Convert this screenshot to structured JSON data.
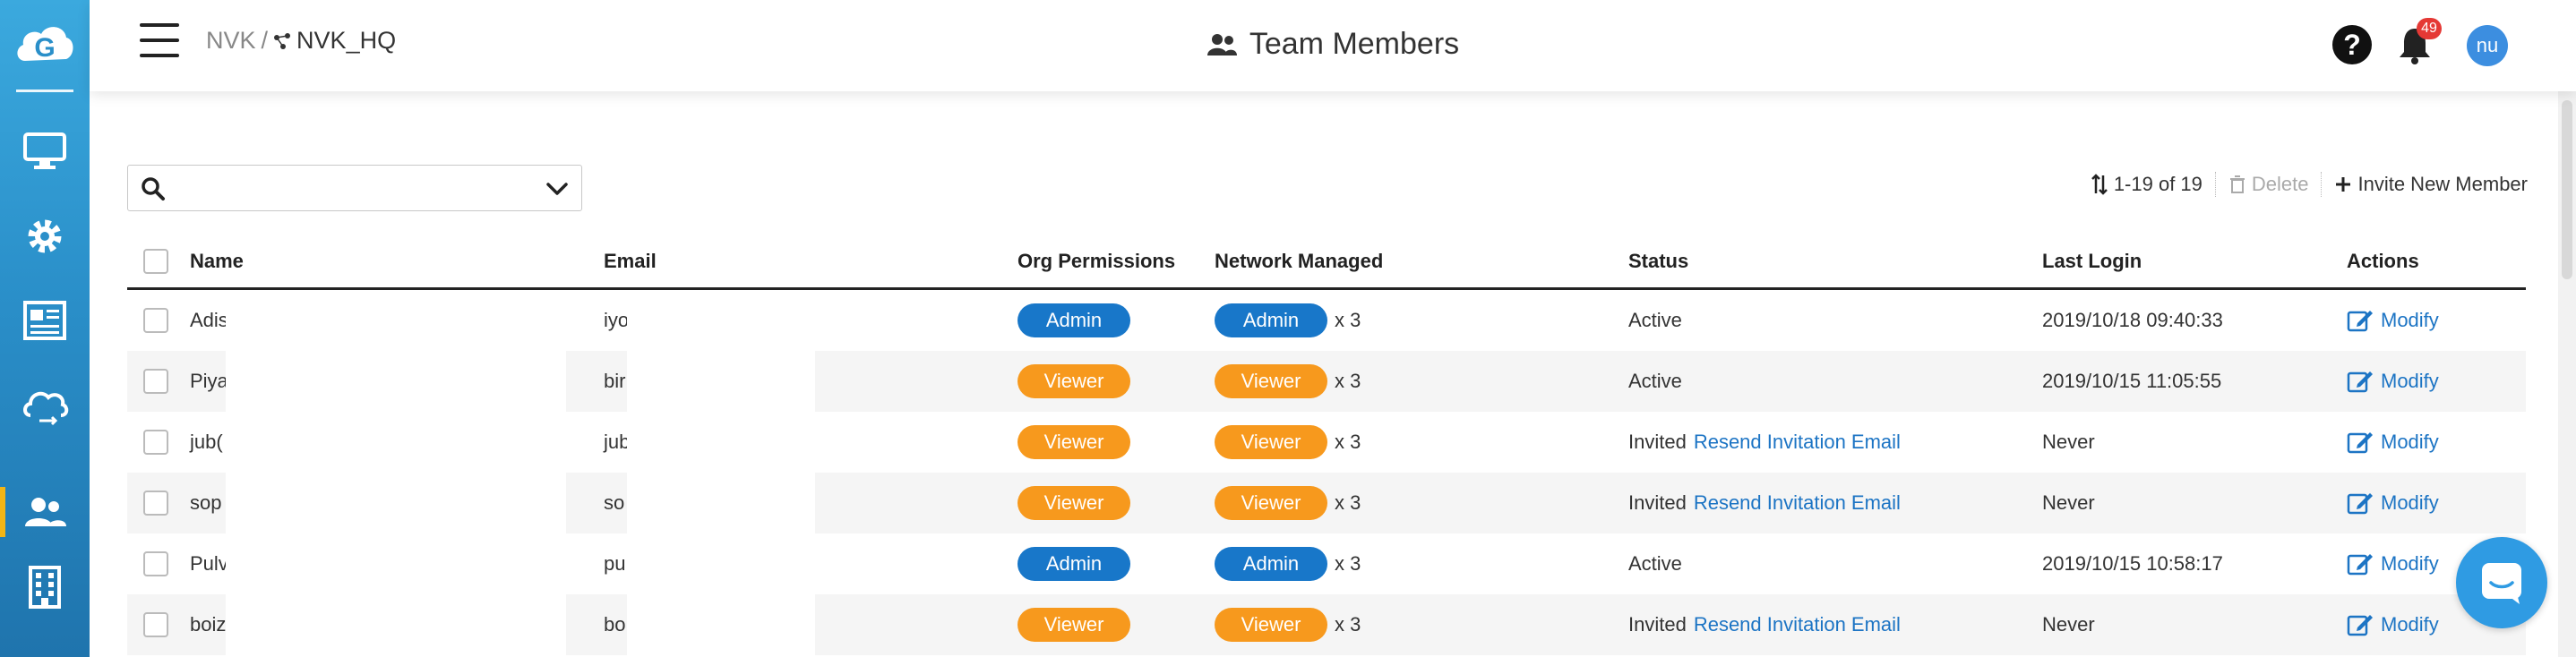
{
  "breadcrumb": {
    "org": "NVK",
    "separator": "/",
    "network": "NVK_HQ"
  },
  "header": {
    "title": "Team Members",
    "notification_count": "49",
    "avatar_initials": "nu"
  },
  "sidebar": {
    "items": [
      {
        "icon": "monitor-icon"
      },
      {
        "icon": "gear-icon"
      },
      {
        "icon": "report-icon"
      },
      {
        "icon": "cloud-sync-icon"
      },
      {
        "icon": "team-icon",
        "active": true
      },
      {
        "icon": "building-icon"
      }
    ],
    "active_color": "#f2b516"
  },
  "search": {
    "placeholder": "",
    "value": ""
  },
  "toolbar": {
    "count_label": "1-19 of 19",
    "delete_label": "Delete",
    "invite_label": "Invite New Member"
  },
  "table": {
    "columns": [
      "Name",
      "Email",
      "Org Permissions",
      "Network Managed",
      "Status",
      "Last Login",
      "Actions"
    ],
    "rows": [
      {
        "name": "Adis",
        "email": "iyo",
        "org_perm": "Admin",
        "net_perm": "Admin",
        "net_mult": "x 3",
        "status": "Active",
        "resend": "",
        "last_login": "2019/10/18 09:40:33",
        "action": "Modify"
      },
      {
        "name": "Piya",
        "email": "bir",
        "org_perm": "Viewer",
        "net_perm": "Viewer",
        "net_mult": "x 3",
        "status": "Active",
        "resend": "",
        "last_login": "2019/10/15 11:05:55",
        "action": "Modify"
      },
      {
        "name": "jub(",
        "email": "jub",
        "org_perm": "Viewer",
        "net_perm": "Viewer",
        "net_mult": "x 3",
        "status": "Invited",
        "resend": "Resend Invitation Email",
        "last_login": "Never",
        "action": "Modify"
      },
      {
        "name": "sop",
        "email": "so",
        "org_perm": "Viewer",
        "net_perm": "Viewer",
        "net_mult": "x 3",
        "status": "Invited",
        "resend": "Resend Invitation Email",
        "last_login": "Never",
        "action": "Modify"
      },
      {
        "name": "Pulv",
        "email": "pu",
        "org_perm": "Admin",
        "net_perm": "Admin",
        "net_mult": "x 3",
        "status": "Active",
        "resend": "",
        "last_login": "2019/10/15 10:58:17",
        "action": "Modify"
      },
      {
        "name": "boiz",
        "email": "bo",
        "org_perm": "Viewer",
        "net_perm": "Viewer",
        "net_mult": "x 3",
        "status": "Invited",
        "resend": "Resend Invitation Email",
        "last_login": "Never",
        "action": "Modify"
      }
    ]
  },
  "colors": {
    "admin": "#1877c9",
    "viewer": "#f7991d",
    "link": "#1c74c4",
    "sidebar_top": "#3ba9de",
    "sidebar_bottom": "#1f74ad"
  }
}
